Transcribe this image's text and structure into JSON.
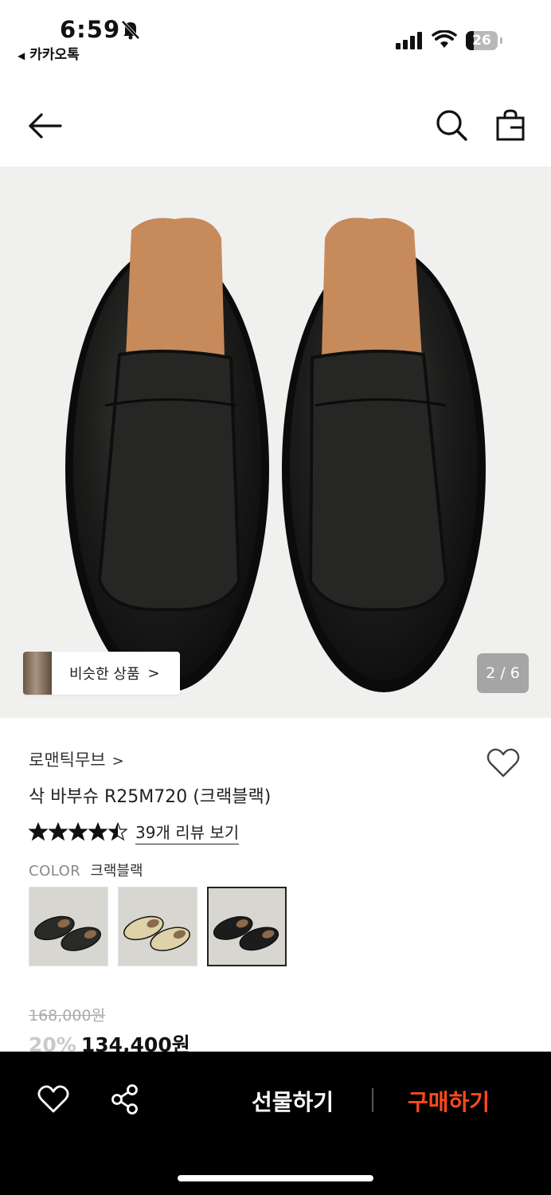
{
  "status_bar": {
    "time": "6:59",
    "back_app": "카카오톡",
    "battery": "26",
    "battery_level": 0.26
  },
  "header": {
    "back_icon": "arrow-left-icon",
    "search_icon": "search-icon",
    "bag_icon": "shopping-bag-icon"
  },
  "gallery": {
    "similar_label": "비슷한 상품",
    "similar_chevron": ">",
    "counter": "2 / 6"
  },
  "product": {
    "brand": "로맨틱무브",
    "brand_chevron": ">",
    "title": "삭 바부슈 R25M720 (크랙블랙)",
    "rating": 4.5,
    "review_link": "39개 리뷰 보기",
    "color_key": "COLOR",
    "color_value": "크랙블랙",
    "swatches": [
      {
        "color": "#2a2a28",
        "selected": false
      },
      {
        "color": "#ddd2a8",
        "selected": false
      },
      {
        "color": "#1c1c1c",
        "selected": true
      }
    ],
    "original_price": "168,000원",
    "discount": "20%",
    "sale_price": "134,400원"
  },
  "bottom_bar": {
    "gift_label": "선물하기",
    "buy_label": "구매하기",
    "buy_color": "#ff4a1c"
  }
}
